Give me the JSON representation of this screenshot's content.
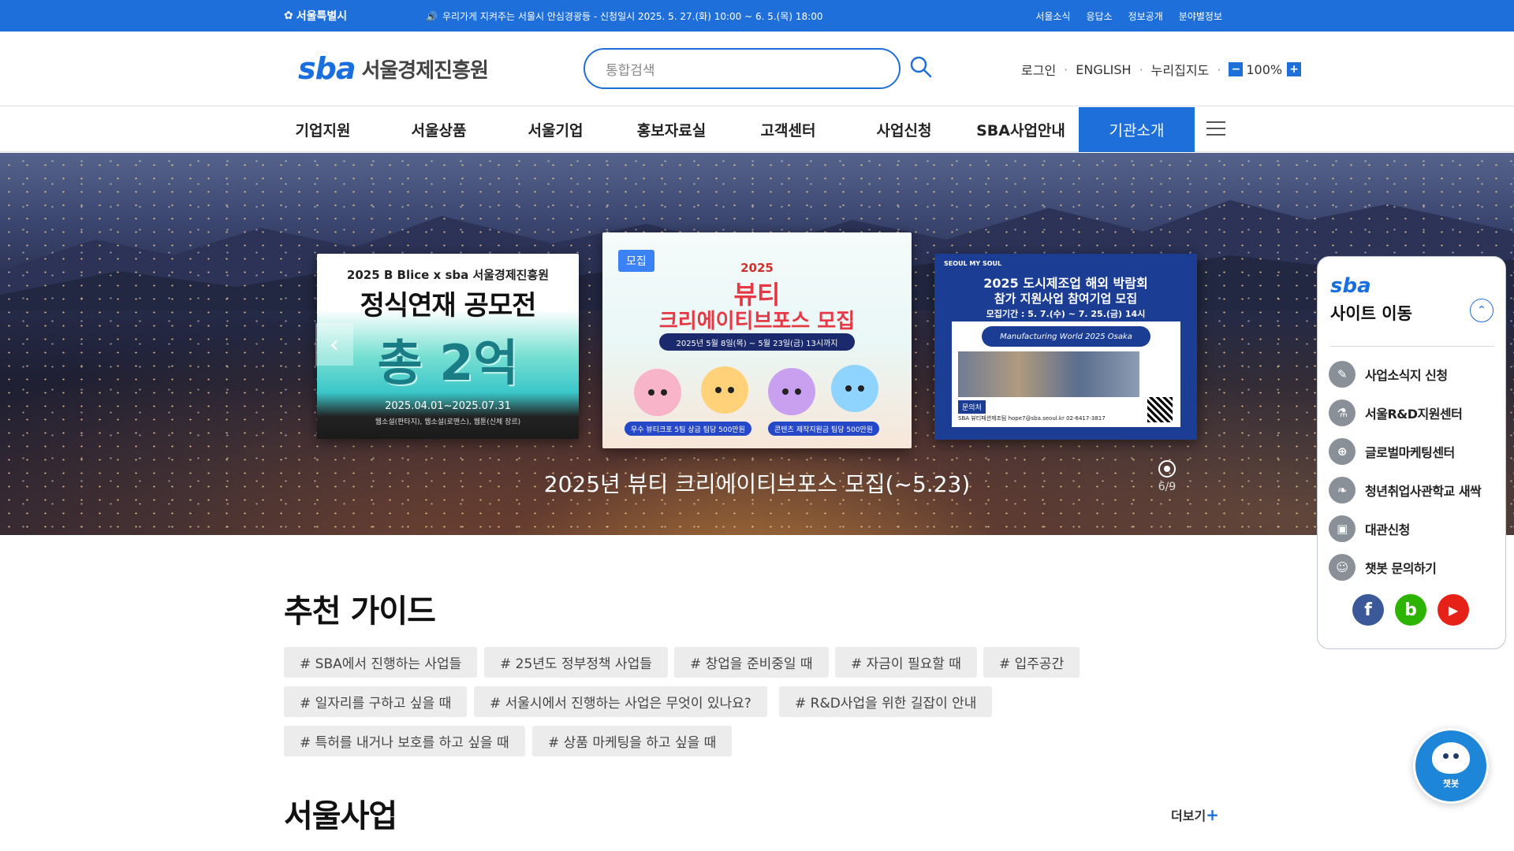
{
  "topbar": {
    "logo": "서울특별시",
    "notice": "우리가게 지켜주는 서울시 안심경광등 - 신청일시 2025. 5. 27.(화) 10:00 ~ 6. 5.(목) 18:00",
    "links": [
      "서울소식",
      "응답소",
      "정보공개",
      "분야별정보"
    ]
  },
  "header": {
    "brand_sba": "sba",
    "brand_name": "서울경제진흥원",
    "search_placeholder": "통합검색",
    "util": {
      "login": "로그인",
      "english": "ENGLISH",
      "sitemap": "누리집지도",
      "zoom_minus": "−",
      "zoom": "100%",
      "zoom_plus": "+"
    }
  },
  "nav": {
    "items": [
      "기업지원",
      "서울상품",
      "서울기업",
      "홍보자료실",
      "고객센터",
      "사업신청",
      "SBA사업안내",
      "기관소개"
    ],
    "active_index": 7
  },
  "hero": {
    "card1": {
      "line1": "2025 B Blice x sba 서울경제진흥원",
      "line2": "정식연재 공모전",
      "line3": "총 2억",
      "line4": "2025.04.01~2025.07.31",
      "line5": "웹소설(판타지), 웹소설(로맨스), 웹툰(신체 장르)"
    },
    "card2": {
      "badge": "모집",
      "year": "2025",
      "line1": "뷰티",
      "line2": "크리에이티브포스 모집",
      "date": "2025년 5월 8일(목) ~ 5월 23일(금) 13시까지",
      "tag1": "우수 뷰티크포 5팀 상금 팀당 500만원",
      "tag2": "콘텐츠 제작지원금 팀당 500만원"
    },
    "card3": {
      "brand": "SEOUL MY SOUL",
      "line1": "2025 도시제조업 해외 박람회",
      "line2": "참가 지원사업 참여기업 모집",
      "period": "모집기간 : 5. 7.(수) ~ 7. 25.(금) 14시",
      "event": "Manufacturing World 2025 Osaka",
      "contact_label": "문의처",
      "contact": "SBA 뷰티패션제조팀 hope7@sba.seoul.kr 02-6417-3817"
    },
    "caption": "2025년 뷰티 크리에이티브포스 모집(~5.23)",
    "counter": "6/9",
    "prev": "‹",
    "next": "›"
  },
  "guide": {
    "title": "추천 가이드",
    "tags": [
      "# SBA에서 진행하는 사업들",
      "# 25년도 정부정책 사업들",
      "# 창업을 준비중일 때",
      "# 자금이 필요할 때",
      "# 입주공간",
      "# 일자리를 구하고 싶을 때",
      "# 서울시에서 진행하는 사업은 무엇이 있나요?",
      "# R&D사업을 위한 길잡이 안내",
      "# 특허를 내거나 보호를 하고 싶을 때",
      "# 상품 마케팅을 하고 싶을 때"
    ]
  },
  "business": {
    "title": "서울사업",
    "more": "더보기",
    "more_plus": "+"
  },
  "sitepanel": {
    "logo": "sba",
    "title": "사이트 이동",
    "toggle": "⌃",
    "links": [
      "사업소식지 신청",
      "서울R&D지원센터",
      "글로벌마케팅센터",
      "청년취업사관학교 새싹",
      "대관신청",
      "챗봇 문의하기"
    ],
    "icons": [
      "✎",
      "⚗",
      "⊕",
      "❧",
      "▣",
      "☺"
    ],
    "social": [
      "f",
      "b",
      "▶"
    ]
  },
  "chatbot": {
    "label": "챗봇"
  },
  "colors": {
    "primary": "#1e6fd9",
    "facebook": "#3b5998",
    "blog": "#2db400",
    "youtube": "#e62117"
  }
}
